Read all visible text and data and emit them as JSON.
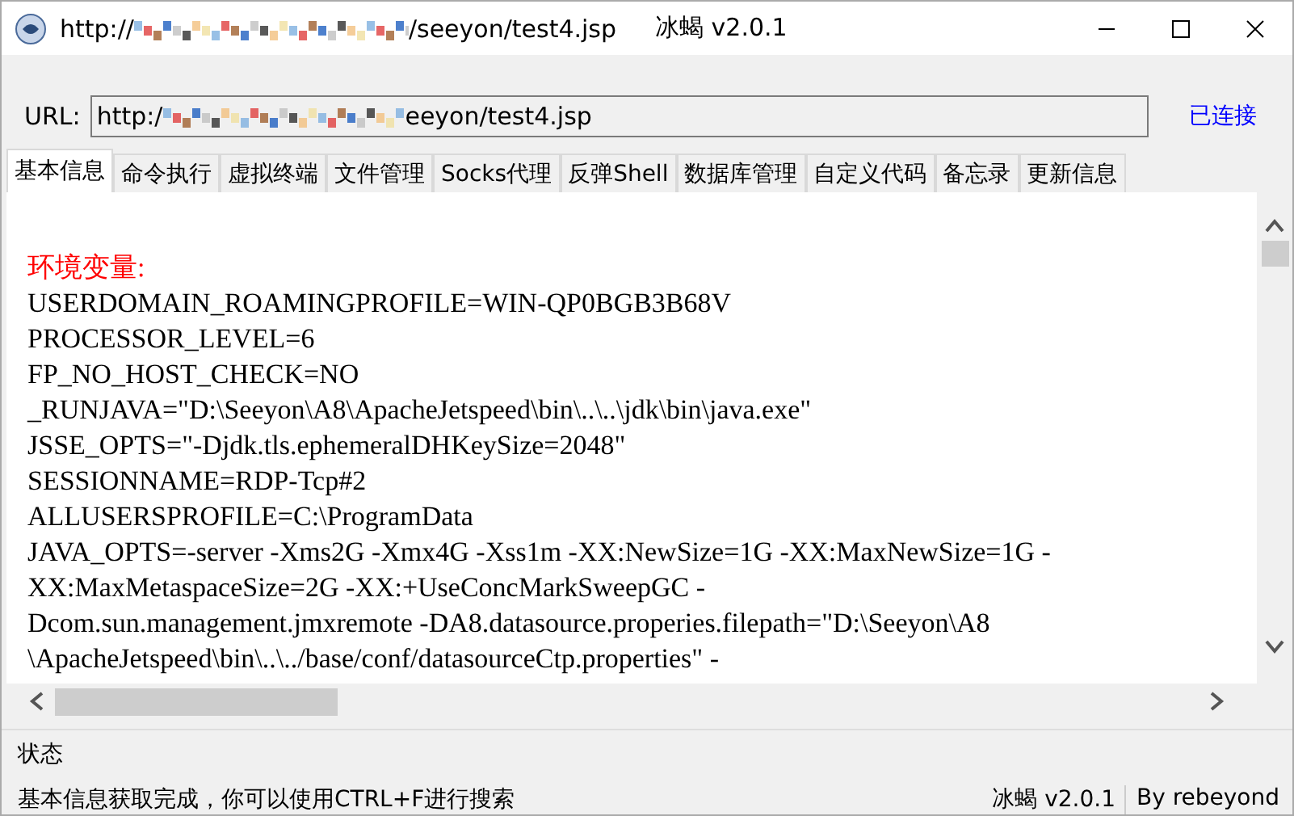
{
  "window": {
    "title_start": "http://",
    "title_end": "/seeyon/test4.jsp",
    "app_name": "冰蝎 v2.0.1"
  },
  "url_bar": {
    "label": "URL:",
    "value_start": "http:/",
    "value_end": "eeyon/test4.jsp",
    "status": "已连接"
  },
  "tabs": [
    {
      "label": "基本信息",
      "selected": true
    },
    {
      "label": "命令执行",
      "selected": false
    },
    {
      "label": "虚拟终端",
      "selected": false
    },
    {
      "label": "文件管理",
      "selected": false
    },
    {
      "label": "Socks代理",
      "selected": false
    },
    {
      "label": "反弹Shell",
      "selected": false
    },
    {
      "label": "数据库管理",
      "selected": false
    },
    {
      "label": "自定义代码",
      "selected": false
    },
    {
      "label": "备忘录",
      "selected": false
    },
    {
      "label": "更新信息",
      "selected": false
    }
  ],
  "content": {
    "heading": "环境变量:",
    "lines": [
      "USERDOMAIN_ROAMINGPROFILE=WIN-QP0BGB3B68V",
      "PROCESSOR_LEVEL=6",
      "FP_NO_HOST_CHECK=NO",
      "_RUNJAVA=\"D:\\Seeyon\\A8\\ApacheJetspeed\\bin\\..\\..\\jdk\\bin\\java.exe\"",
      "JSSE_OPTS=\"-Djdk.tls.ephemeralDHKeySize=2048\"",
      "SESSIONNAME=RDP-Tcp#2",
      "ALLUSERSPROFILE=C:\\ProgramData",
      "JAVA_OPTS=-server -Xms2G -Xmx4G -Xss1m -XX:NewSize=1G -XX:MaxNewSize=1G -",
      "XX:MaxMetaspaceSize=2G -XX:+UseConcMarkSweepGC -",
      "Dcom.sun.management.jmxremote -DA8.datasource.properies.filepath=\"D:\\Seeyon\\A8",
      "\\ApacheJetspeed\\bin\\..\\../base/conf/datasourceCtp.properties\" -"
    ]
  },
  "status_bar": {
    "label": "状态",
    "message": "基本信息获取完成，你可以使用CTRL+F进行搜索",
    "version": "冰蝎 v2.0.1",
    "author": "By rebeyond"
  }
}
